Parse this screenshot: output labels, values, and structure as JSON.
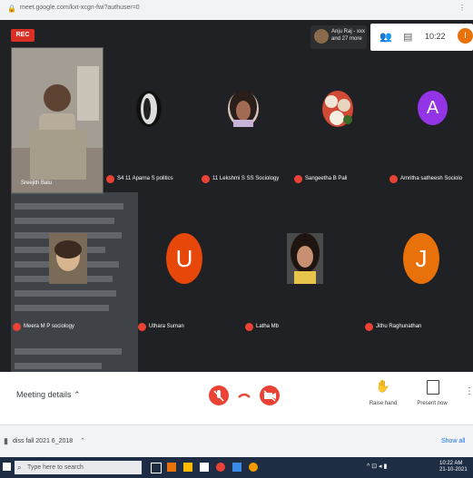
{
  "browser": {
    "url": "meet.google.com/kxt-xcgn-fwi?authuser=0",
    "right_text": "⋮"
  },
  "meet": {
    "rec_label": "REC",
    "participants_summary": "Anju Raj - xxx and 27 more",
    "time": "10:22",
    "self_initial": "I",
    "self_name": "Sreejith Balu",
    "tiles": [
      {
        "name": "S4 11 Aparna S politics",
        "initial": ""
      },
      {
        "name": "11 Lekshmi S SS Sociology",
        "initial": ""
      },
      {
        "name": "Sangeetha B Pali",
        "initial": ""
      },
      {
        "name": "Amritha satheesh Sociolo",
        "initial": "A"
      },
      {
        "name": "Meera M P sociology",
        "initial": ""
      },
      {
        "name": "Uthara Suman",
        "initial": "U"
      },
      {
        "name": "Latha Mb",
        "initial": ""
      },
      {
        "name": "Jithu Raghunathan",
        "initial": "J"
      }
    ],
    "meeting_details": "Meeting details",
    "raise_hand": "Raise hand",
    "present_now": "Present now"
  },
  "downloads": {
    "file": "diss fall 2021 6_2018",
    "show_all": "Show all"
  },
  "taskbar": {
    "search_placeholder": "Type here to search",
    "clock_time": "10:22 AM",
    "clock_date": "21-10-2021"
  },
  "colors": {
    "dark_bg": "#202124",
    "tile": "#3c4043",
    "orange": "#e8470a",
    "purple": "#9334e6",
    "red": "#ea4335"
  }
}
